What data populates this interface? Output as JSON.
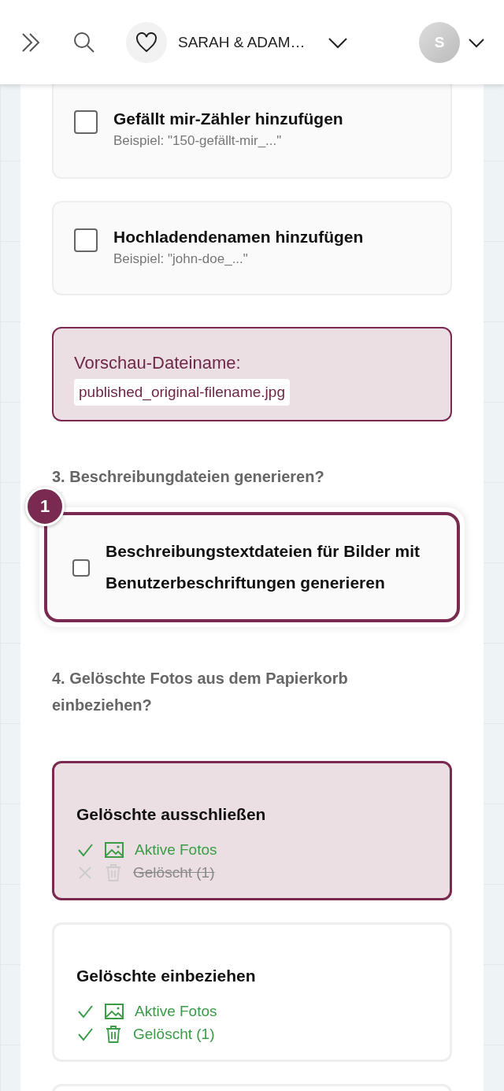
{
  "header": {
    "account_name": "SARAH & ADAM…",
    "avatar_letter": "S"
  },
  "checkbox_options": [
    {
      "label": "Gefällt mir-Zähler hinzufügen",
      "example": "Beispiel: \"150-gefällt-mir_...\"",
      "checked": false
    },
    {
      "label": "Hochladendenamen hinzufügen",
      "example": "Beispiel: \"john-doe_...\"",
      "checked": false
    }
  ],
  "preview": {
    "label": "Vorschau-Dateiname:",
    "filename": "published_original-filename.jpg"
  },
  "section_3": {
    "heading": "3. Beschreibungdateien generieren?",
    "badge": "1",
    "option": {
      "label": "Beschreibungstextdateien für Bilder mit Benutzerbeschriftungen generieren",
      "checked": false
    }
  },
  "section_4": {
    "heading": "4. Gelöschte Fotos aus dem Papierkorb einbeziehen?",
    "choices": [
      {
        "title": "Gelöschte ausschließen",
        "selected": true,
        "features": [
          {
            "kind": "photos",
            "label": "Aktive Fotos",
            "included": true
          },
          {
            "kind": "trash",
            "label": "Gelöscht (1)",
            "included": false
          }
        ]
      },
      {
        "title": "Gelöschte einbeziehen",
        "selected": false,
        "features": [
          {
            "kind": "photos",
            "label": "Aktive Fotos",
            "included": true
          },
          {
            "kind": "trash",
            "label": "Gelöscht (1)",
            "included": true
          }
        ]
      }
    ]
  }
}
